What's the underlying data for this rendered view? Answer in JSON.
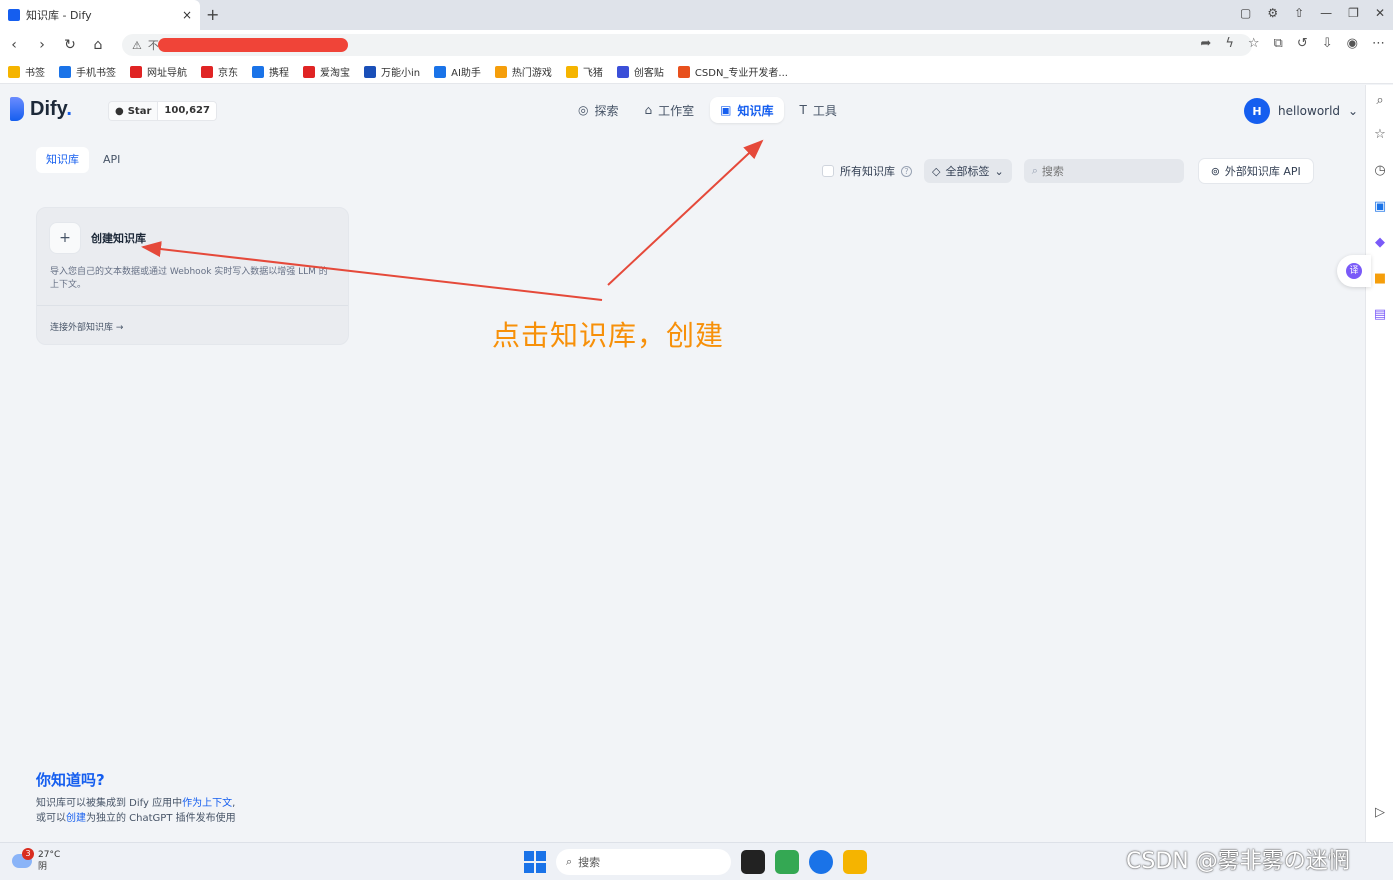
{
  "browser": {
    "tab_title": "知识库 - Dify",
    "tab_close": "×",
    "new_tab": "+",
    "url_prefix": "不安全",
    "bookmarks": [
      {
        "label": "书签",
        "color": "#f5b400"
      },
      {
        "label": "手机书签",
        "color": "#1a73e8"
      },
      {
        "label": "网址导航",
        "color": "#e02424"
      },
      {
        "label": "京东",
        "color": "#e02424"
      },
      {
        "label": "携程",
        "color": "#1a73e8"
      },
      {
        "label": "爱淘宝",
        "color": "#e02424"
      },
      {
        "label": "万能小in",
        "color": "#1a4fb8"
      },
      {
        "label": "AI助手",
        "color": "#1a73e8"
      },
      {
        "label": "热门游戏",
        "color": "#f59e0b"
      },
      {
        "label": "飞猪",
        "color": "#f5b400"
      },
      {
        "label": "创客贴",
        "color": "#3b4fd8"
      },
      {
        "label": "CSDN_专业开发者...",
        "color": "#e8501d"
      }
    ]
  },
  "app": {
    "logo_text": "Dify",
    "logo_dot": ".",
    "github_star_label": "Star",
    "github_star_count": "100,627",
    "nav": [
      {
        "label": "探索",
        "icon": "compass-icon",
        "glyph": "◎",
        "active": false
      },
      {
        "label": "工作室",
        "icon": "robot-icon",
        "glyph": "⌂",
        "active": false
      },
      {
        "label": "知识库",
        "icon": "book-icon",
        "glyph": "▣",
        "active": true
      },
      {
        "label": "工具",
        "icon": "hammer-icon",
        "glyph": "T",
        "active": false
      }
    ],
    "user": {
      "avatar_letter": "H",
      "name": "helloworld",
      "caret": "⌄"
    },
    "subtabs": [
      {
        "label": "知识库",
        "active": true
      },
      {
        "label": "API",
        "active": false
      }
    ],
    "filters": {
      "all_knowledge_label": "所有知识库",
      "tags_label": "全部标签",
      "search_placeholder": "搜索",
      "external_api_label": "外部知识库 API"
    },
    "create_card": {
      "plus": "+",
      "title": "创建知识库",
      "description": "导入您自己的文本数据或通过 Webhook 实时写入数据以增强 LLM 的上下文。",
      "connect_link": "连接外部知识库 →"
    },
    "tips": {
      "title": "你知道吗?",
      "line1_a": "知识库可以被集成到 Dify 应用中",
      "line1_link": "作为上下文",
      "line1_b": ",",
      "line2_a": "或可以",
      "line2_link": "创建",
      "line2_b": "为独立的 ChatGPT 插件发布使用"
    }
  },
  "annotation": {
    "text": "点击知识库，创建",
    "color": "#f79009",
    "arrow_color": "#e5493a"
  },
  "taskbar": {
    "weather_badge": "3",
    "temperature": "27°C",
    "weather": "阴",
    "search_label": "搜索",
    "watermark": "CSDN @雾非雾の迷惘"
  },
  "colors": {
    "accent": "#155eef",
    "page_bg": "#f2f4f7"
  }
}
